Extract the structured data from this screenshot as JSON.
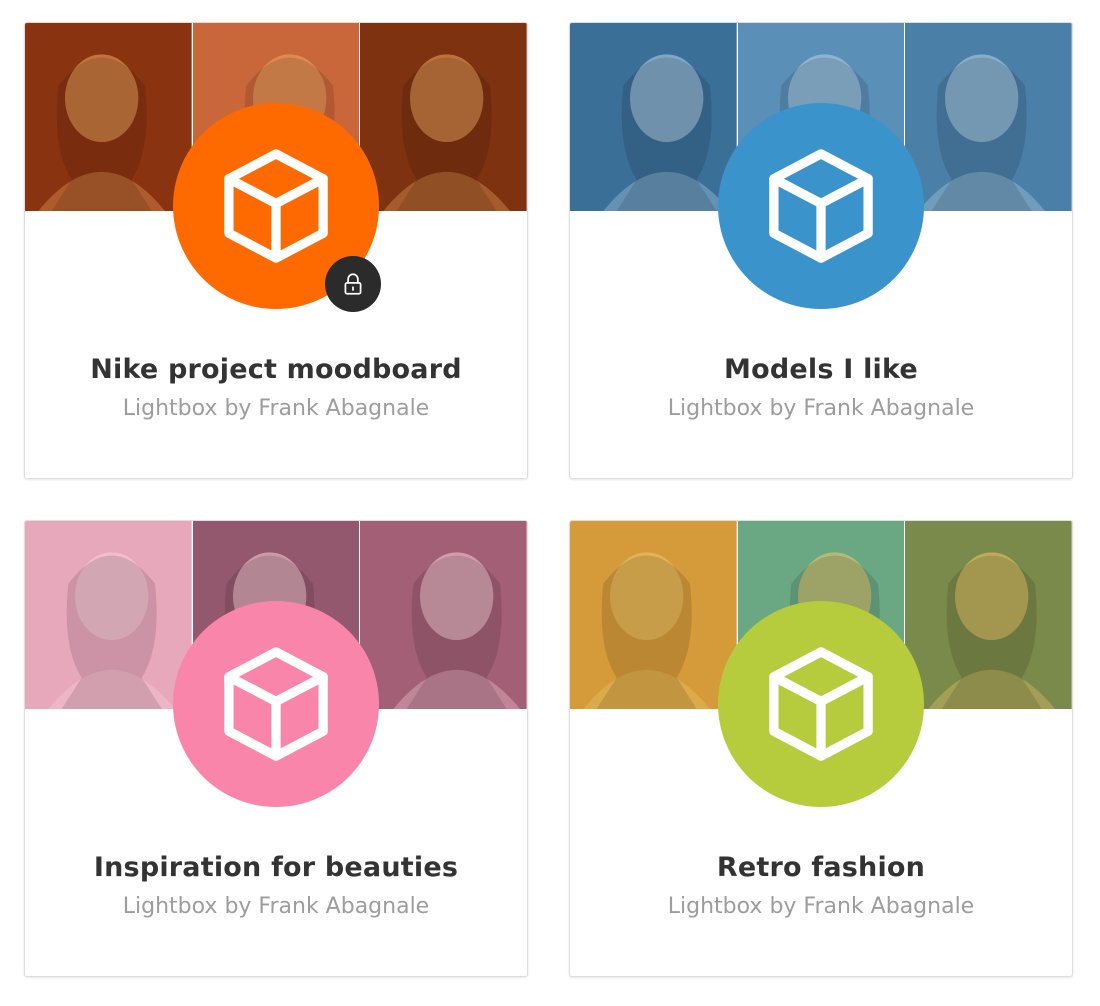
{
  "lightboxes": [
    {
      "title": "Nike project moodboard",
      "subtitle": "Lightbox by Frank Abagnale",
      "accent_color": "#ff6a00",
      "banner_colors": [
        "#8a3310",
        "#c9663a",
        "#7e3210"
      ],
      "banner_highlight": "#f0a860",
      "icon": "cube-icon",
      "locked": true,
      "lock_icon": "lock-icon"
    },
    {
      "title": "Models I like",
      "subtitle": "Lightbox by Frank Abagnale",
      "accent_color": "#3a94cb",
      "banner_colors": [
        "#3a6f98",
        "#5a8fb8",
        "#4a7fa8"
      ],
      "banner_highlight": "#b8d4e8",
      "icon": "cube-icon",
      "locked": false
    },
    {
      "title": "Inspiration for beauties",
      "subtitle": "Lightbox by Frank Abagnale",
      "accent_color": "#f986aa",
      "banner_colors": [
        "#e8a8bc",
        "#94586e",
        "#a35f76"
      ],
      "banner_highlight": "#f8cfd9",
      "icon": "cube-icon",
      "locked": false
    },
    {
      "title": "Retro fashion",
      "subtitle": "Lightbox by Frank Abagnale",
      "accent_color": "#b7cc3c",
      "banner_colors": [
        "#d59a3a",
        "#6aa884",
        "#7a8a4a"
      ],
      "banner_highlight": "#eec96a",
      "icon": "cube-icon",
      "locked": false
    }
  ]
}
